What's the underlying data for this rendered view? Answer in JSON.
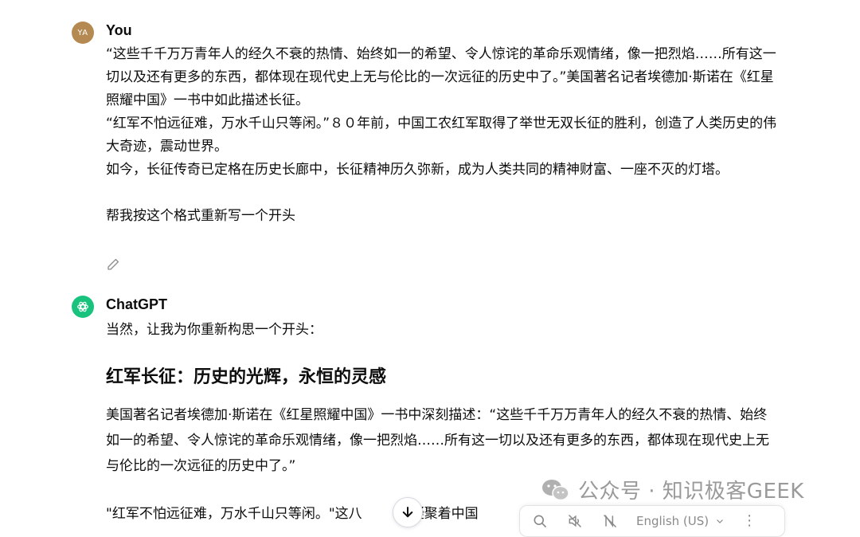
{
  "user_message": {
    "avatar_initials": "YA",
    "author": "You",
    "lines": [
      "“这些千千万万青年人的经久不衰的热情、始终如一的希望、令人惊诧的革命乐观情绪，像一把烈焰……所有这一切以及还有更多的东西，都体现在现代史上无与伦比的一次远征的历史中了。”美国著名记者埃德加·斯诺在《红星照耀中国》一书中如此描述长征。",
      "“红军不怕远征难，万水千山只等闲。”８０年前，中国工农红军取得了举世无双长征的胜利，创造了人类历史的伟大奇迹，震动世界。",
      "如今，长征传奇已定格在历史长廊中，长征精神历久弥新，成为人类共同的精神财富、一座不灭的灯塔。"
    ],
    "request": "帮我按这个格式重新写一个开头"
  },
  "assistant_message": {
    "author": "ChatGPT",
    "intro": "当然，让我为你重新构思一个开头：",
    "heading": "红军长征：历史的光辉，永恒的灵感",
    "paragraph1": "美国著名记者埃德加·斯诺在《红星照耀中国》一书中深刻描述：“这些千千万万青年人的经久不衰的热情、始终如一的希望、令人惊诧的革命乐观情绪，像一把烈焰……所有这一切以及还有更多的东西，都体现在现代史上无与伦比的一次远征的历史中了。”",
    "paragraph2_start": "\"红军不怕远征难，万水千山只等闲。\"这八",
    "paragraph2_end": "，凝聚着中国"
  },
  "watermark": {
    "text": "公众号 · 知识极客GEEK"
  },
  "toolbar": {
    "language": "English (US)"
  },
  "icons": {
    "edit": "pencil-icon",
    "scroll": "arrow-down-icon",
    "search": "search-icon",
    "speaker": "speaker-icon",
    "no_translate": "no-translate-icon",
    "chevron": "chevron-down-icon",
    "more": "more-vertical-icon"
  },
  "colors": {
    "user_avatar": "#b58a52",
    "gpt_avatar": "#19c37d",
    "text": "#0d0d0d",
    "muted": "#8e8e8e"
  }
}
